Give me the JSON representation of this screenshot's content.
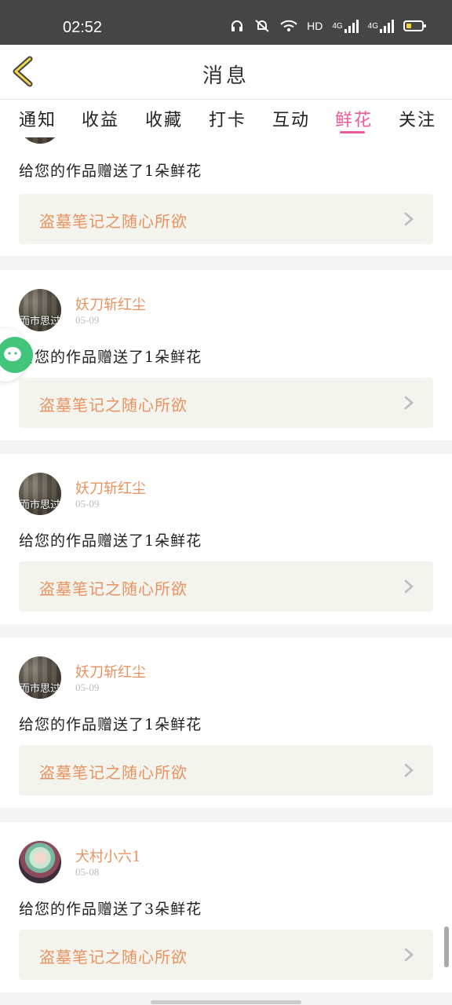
{
  "status_bar": {
    "time": "02:52",
    "network": "HD",
    "sim1": "4G",
    "sim2": "4G"
  },
  "header": {
    "title": "消息"
  },
  "tabs": [
    {
      "label": "通知"
    },
    {
      "label": "收益"
    },
    {
      "label": "收藏"
    },
    {
      "label": "打卡"
    },
    {
      "label": "互动"
    },
    {
      "label": "鲜花",
      "active": true
    },
    {
      "label": "关注"
    }
  ],
  "messages": [
    {
      "username": "",
      "date": "",
      "text": "给您的作品赠送了1朵鲜花",
      "work_title": "盗墓笔记之随心所欲"
    },
    {
      "username": "妖刀斩红尘",
      "date": "05-09",
      "avatar_text": "而市思过",
      "text": "给您的作品赠送了1朵鲜花",
      "work_title": "盗墓笔记之随心所欲"
    },
    {
      "username": "妖刀斩红尘",
      "date": "05-09",
      "avatar_text": "而市思过",
      "text": "给您的作品赠送了1朵鲜花",
      "work_title": "盗墓笔记之随心所欲"
    },
    {
      "username": "妖刀斩红尘",
      "date": "05-09",
      "avatar_text": "而市思过",
      "text": "给您的作品赠送了1朵鲜花",
      "work_title": "盗墓笔记之随心所欲"
    },
    {
      "username": "犬村小六1",
      "date": "05-08",
      "text": "给您的作品赠送了3朵鲜花",
      "work_title": "盗墓笔记之随心所欲"
    }
  ],
  "colors": {
    "accent": "#ec5a9b",
    "username": "#e9925f",
    "status_bar": "#454545",
    "wechat": "#42c47a"
  },
  "icons": {
    "back": "chevron-left-icon",
    "work_arrow": "chevron-right-icon",
    "float": "wechat-icon"
  }
}
